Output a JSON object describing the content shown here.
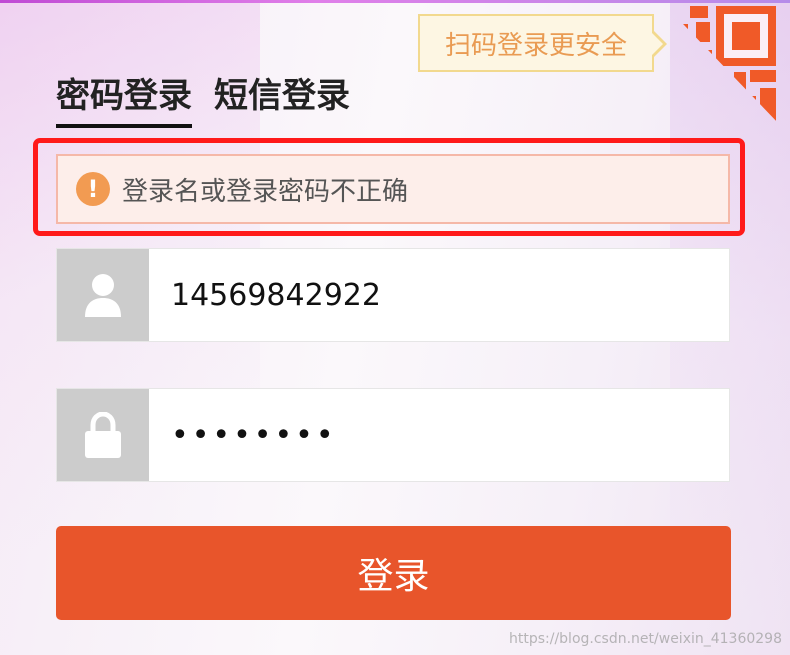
{
  "qr": {
    "tip_text": "扫码登录更安全",
    "icon": "qr-code-icon",
    "color": "#f05a28"
  },
  "tabs": [
    {
      "label": "密码登录",
      "active": true
    },
    {
      "label": "短信登录",
      "active": false
    }
  ],
  "error": {
    "icon": "warning-icon",
    "icon_glyph": "!",
    "message": "登录名或登录密码不正确"
  },
  "username": {
    "icon": "user-icon",
    "value": "14569842922"
  },
  "password": {
    "icon": "lock-icon",
    "masked_value": "••••••••"
  },
  "submit": {
    "label": "登录",
    "color": "#e8552b"
  },
  "watermark": "https://blog.csdn.net/weixin_41360298"
}
